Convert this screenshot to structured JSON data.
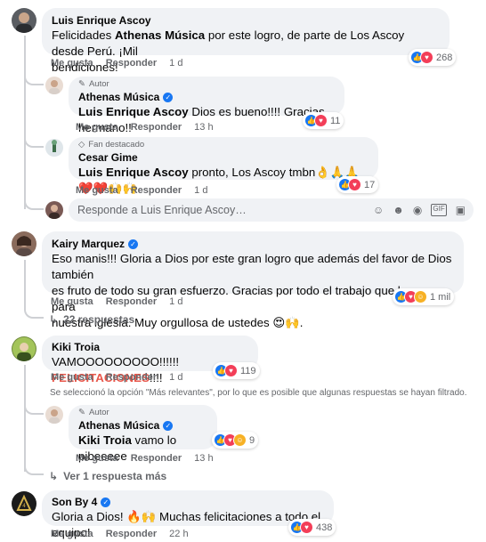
{
  "actions": {
    "like": "Me gusta",
    "reply": "Responder"
  },
  "comment1": {
    "author": "Luis Enrique Ascoy",
    "text_line1": "Felicidades ",
    "mention": "Athenas Música",
    "text_line1_rest": " por este logro, de parte de Los Ascoy desde Perú. ¡Mil",
    "text_line2": "bendiciones!",
    "time": "1 d",
    "reactions_count": "268"
  },
  "reply1": {
    "badge": "Autor",
    "author": "Athenas Música",
    "mention": "Luis Enrique Ascoy",
    "text": " Dios es bueno!!!! Gracias hermano!!",
    "time": "13 h",
    "reactions_count": "11"
  },
  "reply2": {
    "badge": "Fan destacado",
    "author": "Cesar Gime",
    "mention": "Luis Enrique Ascoy",
    "text": " pronto, Los Ascoy tmbn👌🙏🙏❤️❤️🙌🙌",
    "time": "1 d",
    "reactions_count": "17"
  },
  "reply_input": {
    "placeholder": "Responde a Luis Enrique Ascoy…"
  },
  "comment2": {
    "author": "Kairy Marquez",
    "line1": "Eso manis!!! Gloria a Dios por este gran logro que además del favor de Dios también",
    "line2": "es fruto de todo su gran esfuerzo. Gracias por todo el trabajo que hacen para",
    "line3": "nuestra iglesia. Muy orgullosa de ustedes 😍🙌.",
    "time": "1 d",
    "reactions_count": "1 mil",
    "replies_link": "22 respuestas"
  },
  "comment3": {
    "author": "Kiki Troia",
    "text": "VAMOOOOOOOOO!!!!!! ",
    "highlight": "FELICITACIONES",
    "text_end": "!!!!",
    "time": "1 d",
    "reactions_count": "119",
    "filter_note": "Se seleccionó la opción \"Más relevantes\", por lo que es posible que algunas respuestas se hayan filtrado."
  },
  "reply3": {
    "badge": "Autor",
    "author": "Athenas Música",
    "mention": "Kiki Troia",
    "text": " vamo lo pibeeeee",
    "time": "13 h",
    "reactions_count": "9",
    "more_link": "Ver 1 respuesta más"
  },
  "comment4": {
    "author": "Son By 4",
    "text": "Gloria a Dios! 🔥🙌 Muchas felicitaciones a todo el equipo!",
    "time": "22 h",
    "reactions_count": "438"
  },
  "colors": {
    "like": "#1877f2",
    "love": "#f33e58",
    "care": "#f7b125",
    "bubble": "#f0f2f5"
  }
}
